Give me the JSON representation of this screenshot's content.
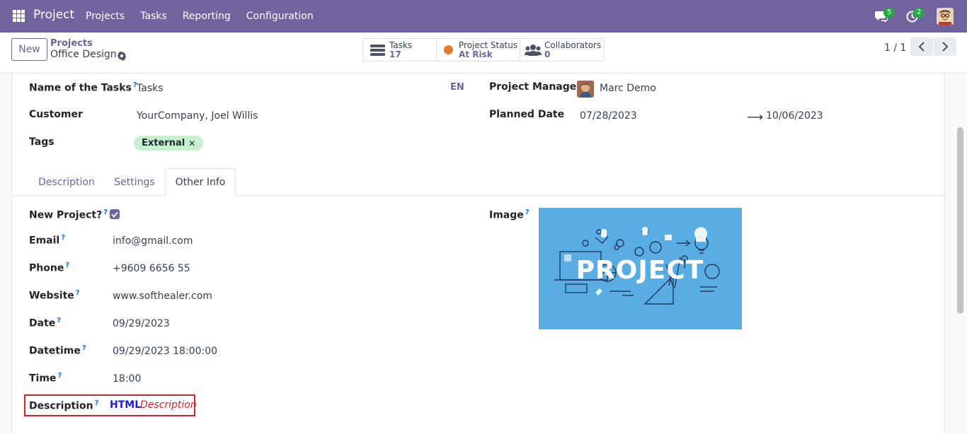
{
  "navbar": {
    "app_name": "Project",
    "menu": [
      "Projects",
      "Tasks",
      "Reporting",
      "Configuration"
    ],
    "chat_badge": "5",
    "activity_badge": "2"
  },
  "control": {
    "new_label": "New",
    "breadcrumb_parent": "Projects",
    "breadcrumb_current": "Office Design",
    "smart_buttons": [
      {
        "label": "Tasks",
        "value": "17"
      },
      {
        "label": "Project Status",
        "value": "At Risk"
      },
      {
        "label": "Collaborators",
        "value": "0"
      }
    ],
    "pager": "1 / 1"
  },
  "form": {
    "name_label": "Name of the Tasks",
    "name_value": "Tasks",
    "lang": "EN",
    "customer_label": "Customer",
    "customer_value": "YourCompany, Joel Willis",
    "tags_label": "Tags",
    "tag": "External",
    "manager_label": "Project Manager",
    "manager_value": "Marc Demo",
    "planned_label": "Planned Date",
    "planned_start": "07/28/2023",
    "planned_end": "10/06/2023",
    "tooltip_mark": "?"
  },
  "tabs": [
    "Description",
    "Settings",
    "Other Info"
  ],
  "other_info": {
    "new_project_label": "New Project?",
    "new_project_checked": true,
    "email_label": "Email",
    "email_value": "info@gmail.com",
    "phone_label": "Phone",
    "phone_value": "+9609 6656 55",
    "website_label": "Website",
    "website_value": "www.softhealer.com",
    "date_label": "Date",
    "date_value": "09/29/2023",
    "datetime_label": "Datetime",
    "datetime_value": "09/29/2023 18:00:00",
    "time_label": "Time",
    "time_value": "18:00",
    "description_label": "Description",
    "description_html": "HTML",
    "description_text": "Description",
    "image_label": "Image",
    "image_text": "PROJECT"
  },
  "colors": {
    "brand": "#71639e",
    "highlight": "#e11d2e",
    "tag_bg": "#c6f0cd",
    "image_bg": "#5aade3"
  }
}
